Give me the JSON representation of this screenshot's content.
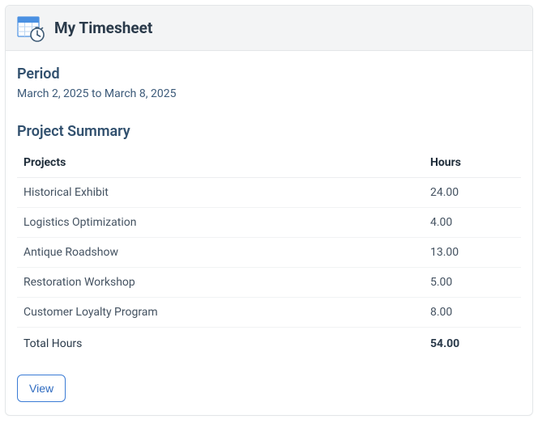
{
  "header": {
    "title": "My Timesheet"
  },
  "period": {
    "section_label": "Period",
    "range": "March 2, 2025 to March 8, 2025"
  },
  "summary": {
    "section_label": "Project Summary",
    "columns": {
      "project": "Projects",
      "hours": "Hours"
    },
    "rows": [
      {
        "project": "Historical Exhibit",
        "hours": "24.00"
      },
      {
        "project": "Logistics Optimization",
        "hours": "4.00"
      },
      {
        "project": "Antique Roadshow",
        "hours": "13.00"
      },
      {
        "project": "Restoration Workshop",
        "hours": "5.00"
      },
      {
        "project": "Customer Loyalty Program",
        "hours": "8.00"
      }
    ],
    "total": {
      "label": "Total Hours",
      "value": "54.00"
    }
  },
  "actions": {
    "view_label": "View"
  }
}
